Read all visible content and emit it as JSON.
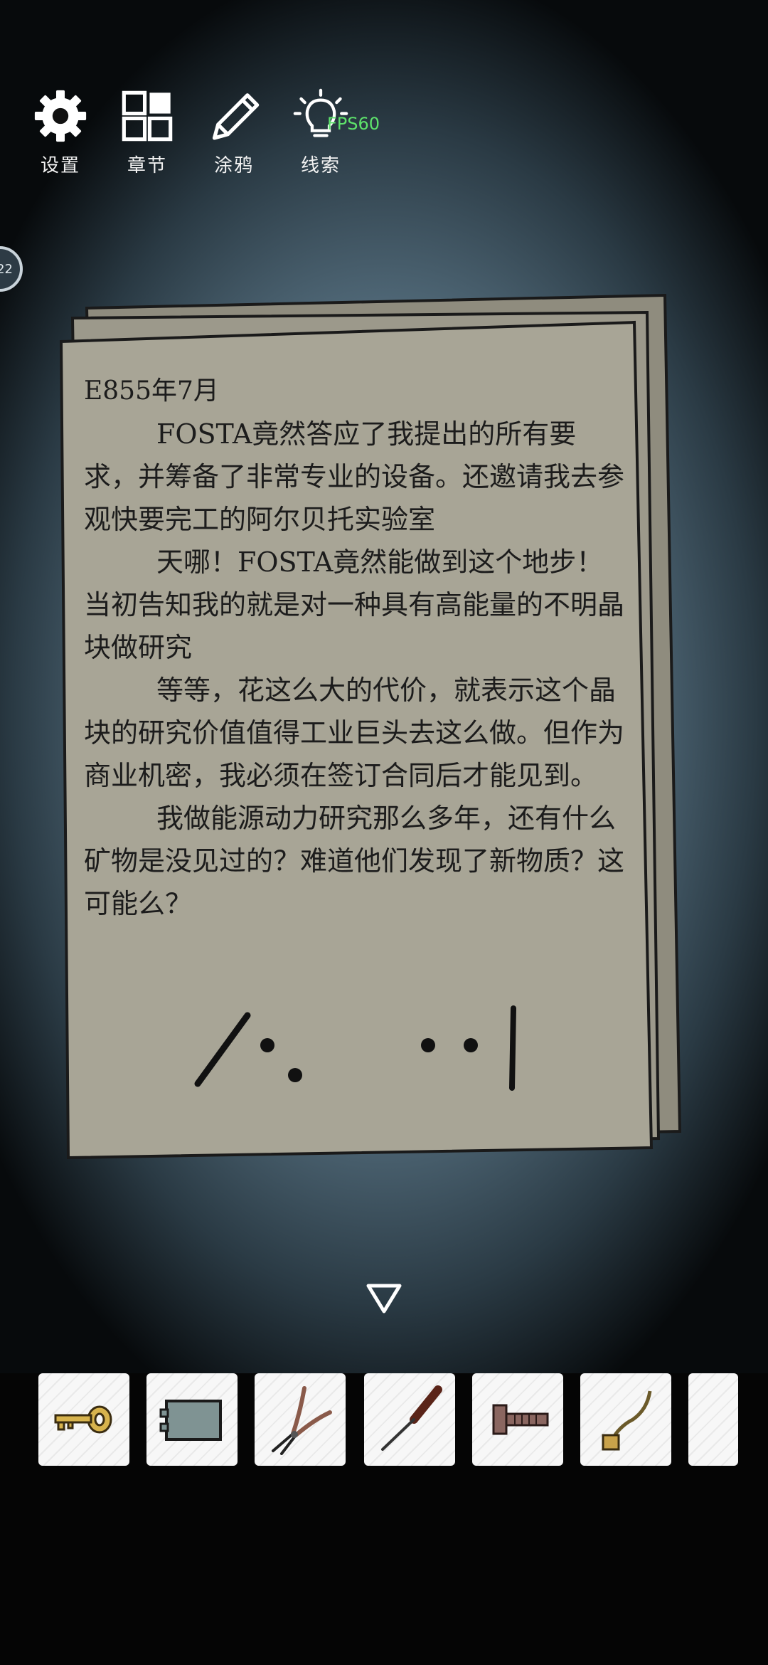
{
  "toolbar": {
    "settings_label": "设置",
    "chapters_label": "章节",
    "doodle_label": "涂鸦",
    "clues_label": "线索"
  },
  "fps_text": "FPS60",
  "side_badge": "22",
  "letter": {
    "date": "E855年7月",
    "paragraphs": [
      "FOSTA竟然答应了我提出的所有要求，并筹备了非常专业的设备。还邀请我去参观快要完工的阿尔贝托实验室",
      "天哪！FOSTA竟然能做到这个地步！当初告知我的就是对一种具有高能量的不明晶块做研究",
      "等等，花这么大的代价，就表示这个晶块的研究价值值得工业巨头去这么做。但作为商业机密，我必须在签订合同后才能见到。",
      "我做能源动力研究那么多年，还有什么矿物是没见过的？难道他们发现了新物质？这可能么？"
    ]
  },
  "inventory": {
    "items": [
      "key-icon",
      "battery-icon",
      "pliers-icon",
      "screwdriver-icon",
      "bolt-icon",
      "wire-icon",
      ""
    ]
  },
  "colors": {
    "paper": "#a8a596",
    "ink": "#1c1c1c",
    "background_center": "#7d98a8",
    "fps_green": "#5ee36b"
  }
}
